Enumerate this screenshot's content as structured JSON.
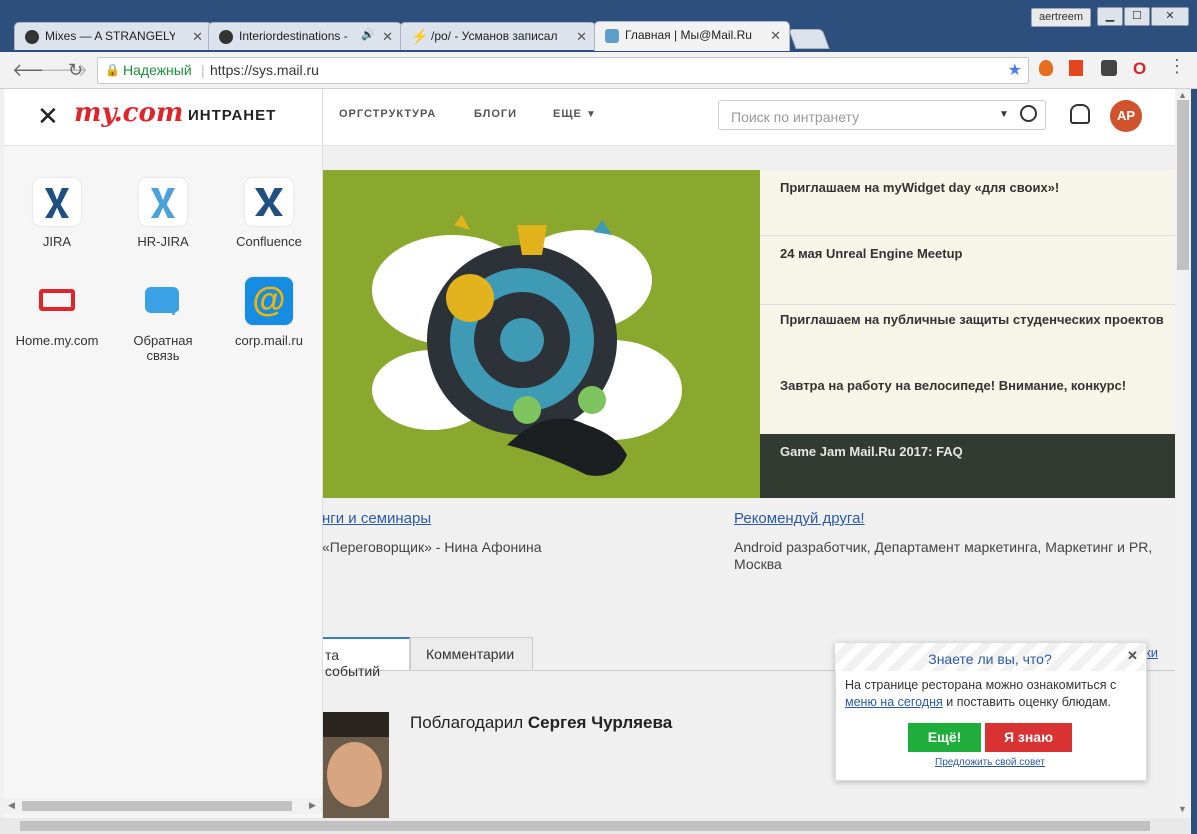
{
  "window": {
    "user_badge": "aertreem"
  },
  "tabs": [
    {
      "label": "Mixes — A STRANGELY I",
      "icon": "github-icon"
    },
    {
      "label": "Interiordestinations -",
      "icon": "github-icon",
      "audio": "🔊"
    },
    {
      "label": "/po/ - Усманов записал",
      "icon": "lightning-icon"
    },
    {
      "label": "Главная | Мы@Mail.Ru",
      "icon": "home-icon"
    }
  ],
  "address_bar": {
    "secure_label": "Надежный",
    "url": "https://sys.mail.ru"
  },
  "top_menu": {
    "org": "ОРГСТРУКТУРА",
    "blogs": "БЛОГИ",
    "more": "ЕЩЕ"
  },
  "search": {
    "placeholder": "Поиск по интранету"
  },
  "user": {
    "initials": "АР"
  },
  "news": [
    "Приглашаем на myWidget day «для своих»!",
    "24 мая Unreal Engine Meetup",
    "Приглашаем на публичные защиты студенческих проектов",
    "Завтра на работу на велосипеде! Внимание, конкурс!",
    "Game Jam Mail.Ru 2017: FAQ"
  ],
  "left_block": {
    "title": "нги и семинары",
    "text": "«Переговорщик» - Нина Афонина"
  },
  "right_block": {
    "title": "Рекомендуй друга!",
    "text": "Android разработчик, Департамент маркетинга, Маркетинг и PR, Москва"
  },
  "feed_tabs": {
    "events": "та событий",
    "comments": "Комментарии",
    "right_link": "ки"
  },
  "feed_item": {
    "prefix": "Поблагодарил ",
    "name": "Сергея Чурляева"
  },
  "side_panel": {
    "logo": "my.com",
    "title": "ИНТРАНЕТ",
    "apps": [
      {
        "label": "JIRA"
      },
      {
        "label": "HR-JIRA"
      },
      {
        "label": "Confluence"
      },
      {
        "label": "Home.my.com"
      },
      {
        "label": "Обратная связь"
      },
      {
        "label": "corp.mail.ru"
      }
    ]
  },
  "popup": {
    "title": "Знаете ли вы, что?",
    "text_before": "На странице ресторана можно ознакомиться с ",
    "link": "меню на сегодня",
    "text_after": " и поставить оценку блюдам.",
    "yes": "Ещё!",
    "know": "Я знаю",
    "suggest": "Предложить свой совет"
  }
}
